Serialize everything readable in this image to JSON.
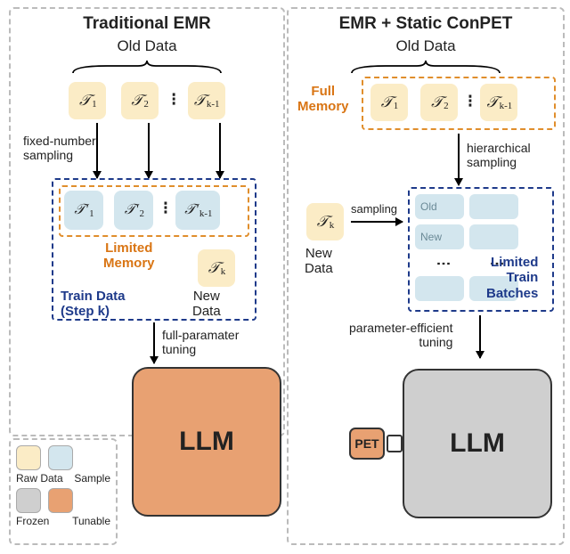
{
  "left": {
    "title": "Traditional EMR",
    "old_data": "Old Data",
    "t1": "𝒯",
    "t1s": "1",
    "t2": "𝒯",
    "t2s": "2",
    "tk1": "𝒯",
    "tk1s": "k-1",
    "dots": "⁝",
    "fixed_sampling": "fixed-number\nsampling",
    "s1": "𝒯'",
    "s1s": "1",
    "s2": "𝒯'",
    "s2s": "2",
    "sk1": "𝒯'",
    "sk1s": "k-1",
    "limited_memory": "Limited\nMemory",
    "tk": "𝒯",
    "tks": "k",
    "train_data": "Train Data\n(Step k)",
    "new_data": "New\nData",
    "full_param": "full-paramater\ntuning",
    "llm": "LLM"
  },
  "right": {
    "title": "EMR + Static ConPET",
    "old_data": "Old Data",
    "t1": "𝒯",
    "t1s": "1",
    "t2": "𝒯",
    "t2s": "2",
    "tk1": "𝒯",
    "tk1s": "k-1",
    "dots": "⁝",
    "full_memory": "Full\nMemory",
    "hier_sampling": "hierarchical\nsampling",
    "tk": "𝒯",
    "tks": "k",
    "new_data": "New\nData",
    "sampling": "sampling",
    "old": "Old",
    "new": "New",
    "limited_batches": "Limited\nTrain\nBatches",
    "pet_tuning": "parameter-efficient\ntuning",
    "pet": "PET",
    "llm": "LLM"
  },
  "legend": {
    "raw": "Raw Data",
    "sample": "Sample",
    "frozen": "Frozen",
    "tunable": "Tunable"
  }
}
